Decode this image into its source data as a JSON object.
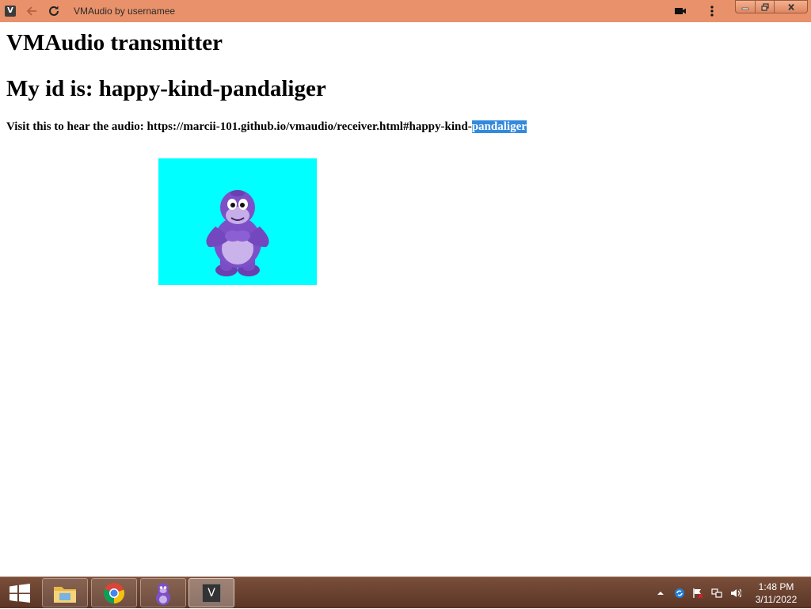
{
  "browser": {
    "app_icon_letter": "V",
    "title": "VMAudio by usernamee",
    "back_icon": "arrow-left-icon",
    "reload_icon": "reload-icon",
    "cast_icon": "video-camera-icon",
    "menu_icon": "kebab-menu-icon"
  },
  "page": {
    "heading": "VMAudio transmitter",
    "id_line": "My id is: happy-kind-pandaliger",
    "visit_prefix": "Visit this to hear the audio: https://marcii-101.github.io/vmaudio/receiver.html#happy-kind-",
    "visit_selected": "pandaliger",
    "image_background": "#00ffff",
    "image_subject": "bonzi-buddy-gorilla"
  },
  "taskbar": {
    "items": [
      {
        "name": "file-explorer",
        "icon": "folder-icon"
      },
      {
        "name": "chrome",
        "icon": "chrome-icon"
      },
      {
        "name": "bonzi-buddy",
        "icon": "gorilla-icon"
      },
      {
        "name": "vmaudio",
        "icon": "v-app-icon",
        "letter": "V",
        "active": true
      }
    ],
    "tray_icons": [
      "chevron-up-icon",
      "sync-icon",
      "flag-icon",
      "network-icon",
      "speaker-icon"
    ],
    "time": "1:48 PM",
    "date": "3/11/2022"
  },
  "colors": {
    "titlebar": "#e8916a",
    "selection": "#3389dc",
    "taskbar": "#6a4030"
  }
}
